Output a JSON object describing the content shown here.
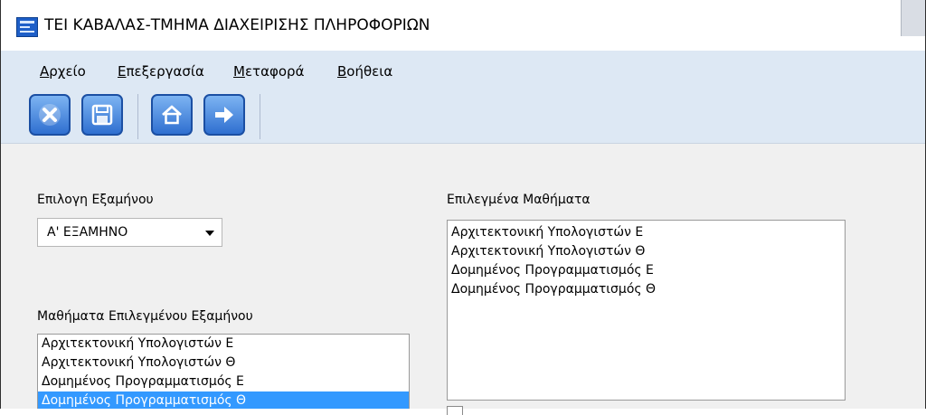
{
  "window": {
    "title": "ΤΕΙ ΚΑΒΑΛΑΣ-ΤΜΗΜΑ ΔΙΑΧΕΙΡΙΣΗΣ ΠΛΗΡΟΦΟΡΙΩΝ"
  },
  "menu": {
    "items": [
      {
        "label": "Αρχείο"
      },
      {
        "label": "Επεξεργασία"
      },
      {
        "label": "Μεταφορά"
      },
      {
        "label": "Βοήθεια"
      }
    ]
  },
  "toolbar": {
    "icons": [
      "close-icon",
      "save-icon",
      "home-icon",
      "arrow-right-icon"
    ]
  },
  "semester": {
    "label": "Επιλογη Εξαμήνου",
    "selected": "Α' ΕΞΑΜΗΝΟ"
  },
  "available_courses": {
    "label": "Μαθήματα Επιλεγμένου Εξαμήνου",
    "items": [
      {
        "text": "Αρχιτεκτονική Υπολογιστών Ε",
        "selected": false
      },
      {
        "text": "Αρχιτεκτονική Υπολογιστών Θ",
        "selected": false
      },
      {
        "text": "Δομημένος Προγραμματισμός Ε",
        "selected": false
      },
      {
        "text": "Δομημένος Προγραμματισμός Θ",
        "selected": true
      }
    ]
  },
  "selected_courses": {
    "label": "Επιλεγμένα Μαθήματα",
    "items": [
      {
        "text": "Αρχιτεκτονική Υπολογιστών Ε"
      },
      {
        "text": "Αρχιτεκτονική Υπολογιστών Θ"
      },
      {
        "text": "Δομημένος Προγραμματισμός Ε"
      },
      {
        "text": "Δομημένος Προγραμματισμός Θ"
      }
    ]
  },
  "colors": {
    "selection": "#3399ff",
    "toolbar_bg": "#dde8f4",
    "button_blue": "#2f6fd0"
  }
}
